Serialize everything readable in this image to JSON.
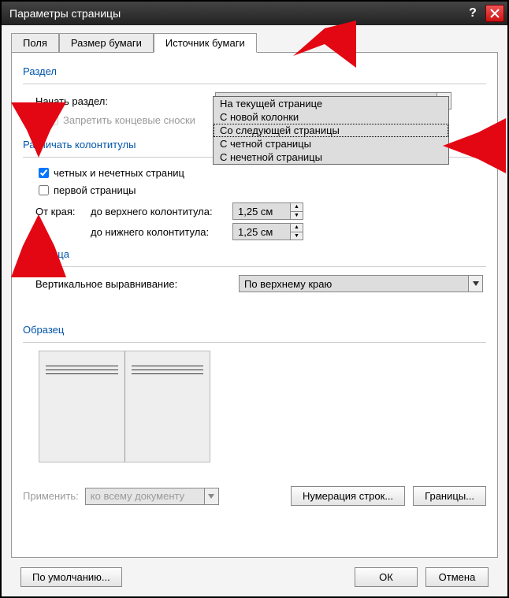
{
  "window": {
    "title": "Параметры страницы"
  },
  "tabs": {
    "fields": "Поля",
    "paper_size": "Размер бумаги",
    "paper_source": "Источник бумаги"
  },
  "section": {
    "group": "Раздел",
    "start_label": "Начать раздел:",
    "start_value": "Со следующей страницы",
    "options": [
      "На текущей странице",
      "С новой колонки",
      "Со следующей страницы",
      "С четной страницы",
      "С нечетной страницы"
    ],
    "suppress_endnotes": "Запретить концевые сноски"
  },
  "headers": {
    "group": "Различать колонтитулы",
    "odd_even": "четных и нечетных страниц",
    "first_page": "первой страницы",
    "from_edge": "От края:",
    "to_header": "до верхнего колонтитула:",
    "to_footer": "до нижнего колонтитула:",
    "header_val": "1,25 см",
    "footer_val": "1,25 см"
  },
  "page": {
    "group": "Страница",
    "valign_label": "Вертикальное выравнивание:",
    "valign_value": "По верхнему краю"
  },
  "preview": {
    "group": "Образец"
  },
  "apply": {
    "label": "Применить:",
    "value": "ко всему документу"
  },
  "buttons": {
    "line_numbers": "Нумерация строк...",
    "borders": "Границы...",
    "defaults": "По умолчанию...",
    "ok": "ОК",
    "cancel": "Отмена"
  }
}
